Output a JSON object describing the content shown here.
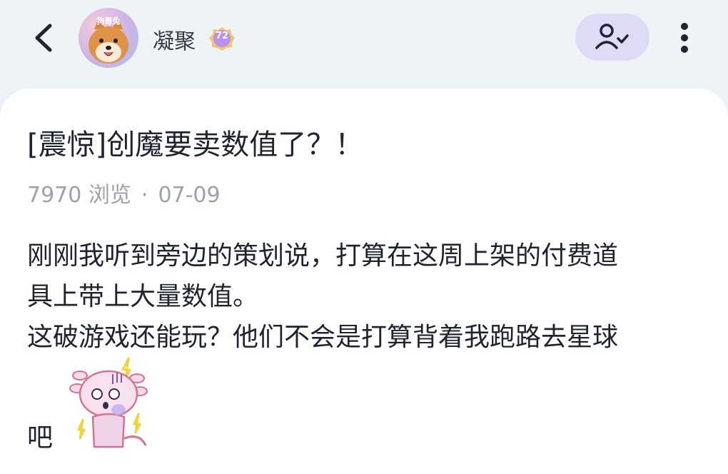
{
  "header": {
    "avatar_caption": "狗哥兔",
    "user_name": "凝聚",
    "level": "72",
    "icons": {
      "back": "chevron-left-icon",
      "follow": "user-check-icon",
      "more": "more-vertical-icon"
    }
  },
  "post": {
    "title": "[震惊]创魔要卖数值了？！",
    "views": "7970 浏览",
    "separator": "·",
    "date": "07-09",
    "lines": [
      "刚刚我听到旁边的策划说，打算在这周上架的付费道",
      "具上带上大量数值。",
      "这破游戏还能玩？他们不会是打算背着我跑路去星球",
      "吧"
    ],
    "sticker": "shocked-axolotl-sticker"
  },
  "colors": {
    "background": "#eef3f6",
    "card": "#ffffff",
    "follow_button": "#dedbf7",
    "level_badge": "#b98ff0",
    "text": "#1f2430",
    "meta_text": "#9da1ab"
  }
}
